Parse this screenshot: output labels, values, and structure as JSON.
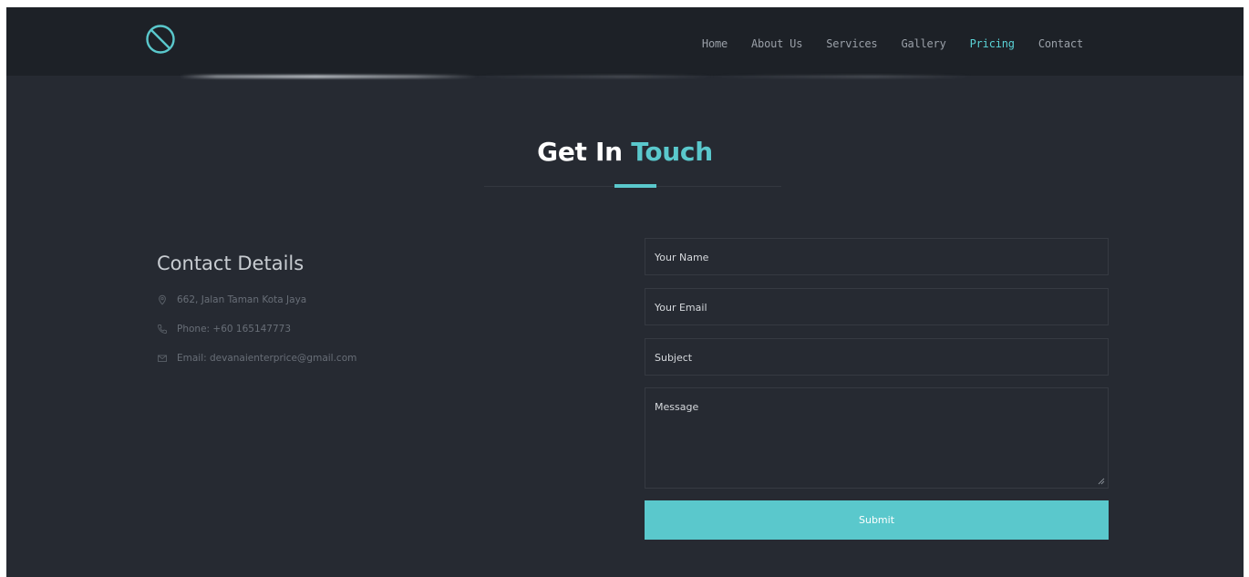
{
  "header": {
    "logo_icon": "circle-slash-logo",
    "nav": [
      {
        "label": "Home",
        "active": false
      },
      {
        "label": "About Us",
        "active": false
      },
      {
        "label": "Services",
        "active": false
      },
      {
        "label": "Gallery",
        "active": false
      },
      {
        "label": "Pricing",
        "active": true
      },
      {
        "label": "Contact",
        "active": false
      }
    ]
  },
  "section": {
    "title_main": "Get In",
    "title_accent": "Touch"
  },
  "contact": {
    "heading": "Contact Details",
    "address": "662, Jalan Taman Kota Jaya",
    "phone": "Phone: +60 165147773",
    "email": "Email: devanaienterprice@gmail.com",
    "icons": [
      "map-pin-icon",
      "phone-icon",
      "envelope-icon"
    ]
  },
  "form": {
    "name_placeholder": "Your Name",
    "email_placeholder": "Your Email",
    "subject_placeholder": "Subject",
    "message_placeholder": "Message",
    "submit_label": "Submit"
  },
  "colors": {
    "accent": "#5ac8cc",
    "background": "#262a32",
    "header": "#1d2127"
  }
}
